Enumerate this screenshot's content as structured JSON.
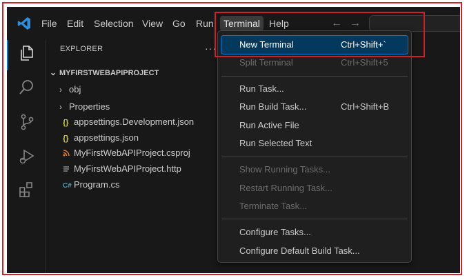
{
  "menubar": {
    "items": [
      "File",
      "Edit",
      "Selection",
      "View",
      "Go",
      "Run",
      "Terminal",
      "Help"
    ]
  },
  "explorer": {
    "title": "EXPLORER",
    "more": "···",
    "project": "MYFIRSTWEBAPIPROJECT",
    "items": [
      {
        "label": "obj",
        "kind": "folder"
      },
      {
        "label": "Properties",
        "kind": "folder"
      },
      {
        "label": "appsettings.Development.json",
        "kind": "json",
        "icon": "{}"
      },
      {
        "label": "appsettings.json",
        "kind": "json",
        "icon": "{}"
      },
      {
        "label": "MyFirstWebAPIProject.csproj",
        "kind": "csproj"
      },
      {
        "label": "MyFirstWebAPIProject.http",
        "kind": "http"
      },
      {
        "label": "Program.cs",
        "kind": "cs",
        "icon": "C#"
      }
    ]
  },
  "terminal_menu": {
    "items": [
      {
        "label": "New Terminal",
        "shortcut": "Ctrl+Shift+`",
        "state": "highlighted"
      },
      {
        "label": "Split Terminal",
        "shortcut": "Ctrl+Shift+5",
        "state": "disabled"
      },
      {
        "label": "Run Task...",
        "shortcut": "",
        "state": "enabled"
      },
      {
        "label": "Run Build Task...",
        "shortcut": "Ctrl+Shift+B",
        "state": "enabled"
      },
      {
        "label": "Run Active File",
        "shortcut": "",
        "state": "enabled"
      },
      {
        "label": "Run Selected Text",
        "shortcut": "",
        "state": "enabled"
      },
      {
        "label": "Show Running Tasks...",
        "shortcut": "",
        "state": "disabled"
      },
      {
        "label": "Restart Running Task...",
        "shortcut": "",
        "state": "disabled"
      },
      {
        "label": "Terminate Task...",
        "shortcut": "",
        "state": "disabled"
      },
      {
        "label": "Configure Tasks...",
        "shortcut": "",
        "state": "enabled"
      },
      {
        "label": "Configure Default Build Task...",
        "shortcut": "",
        "state": "enabled"
      }
    ]
  },
  "colors": {
    "accent": "#0078d4",
    "highlight_bg": "#04395e",
    "annotation_red": "#d21f2a",
    "json_icon": "#cbcb41",
    "cs_icon": "#519aba",
    "csproj_icon": "#e37933"
  }
}
